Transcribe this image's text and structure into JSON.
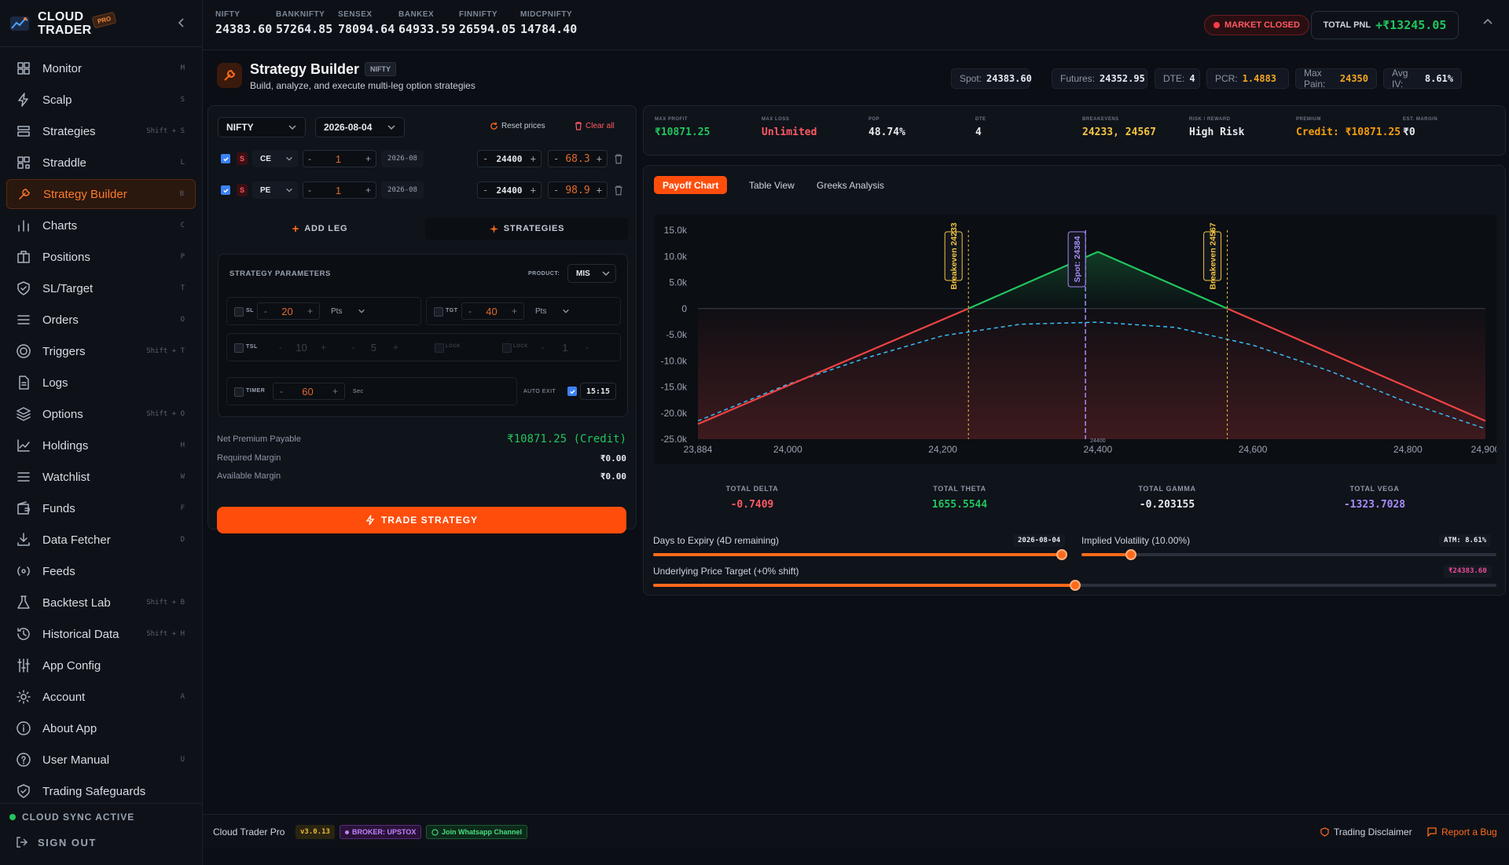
{
  "brand": {
    "line1": "CLOUD",
    "line2": "TRADER",
    "badge": "PRO"
  },
  "nav": [
    {
      "label": "Monitor",
      "shortcut": "M",
      "icon": "grid-icon"
    },
    {
      "label": "Scalp",
      "shortcut": "S",
      "icon": "bolt-icon"
    },
    {
      "label": "Strategies",
      "shortcut": "Shift + S",
      "icon": "layers-icon"
    },
    {
      "label": "Straddle",
      "shortcut": "L",
      "icon": "straddle-icon"
    },
    {
      "label": "Strategy Builder",
      "shortcut": "B",
      "icon": "wrench-icon",
      "active": true
    },
    {
      "label": "Charts",
      "shortcut": "C",
      "icon": "bar-chart-icon"
    },
    {
      "label": "Positions",
      "shortcut": "P",
      "icon": "briefcase-icon"
    },
    {
      "label": "SL/Target",
      "shortcut": "T",
      "icon": "shield-icon"
    },
    {
      "label": "Orders",
      "shortcut": "O",
      "icon": "list-icon"
    },
    {
      "label": "Triggers",
      "shortcut": "Shift + T",
      "icon": "target-icon"
    },
    {
      "label": "Logs",
      "shortcut": "",
      "icon": "file-icon"
    },
    {
      "label": "Options",
      "shortcut": "Shift + O",
      "icon": "stack-icon"
    },
    {
      "label": "Holdings",
      "shortcut": "H",
      "icon": "trend-icon"
    },
    {
      "label": "Watchlist",
      "shortcut": "W",
      "icon": "list-icon"
    },
    {
      "label": "Funds",
      "shortcut": "F",
      "icon": "wallet-icon"
    },
    {
      "label": "Data Fetcher",
      "shortcut": "D",
      "icon": "download-icon"
    },
    {
      "label": "Feeds",
      "shortcut": "",
      "icon": "broadcast-icon"
    },
    {
      "label": "Backtest Lab",
      "shortcut": "Shift + B",
      "icon": "flask-icon"
    },
    {
      "label": "Historical Data",
      "shortcut": "Shift + H",
      "icon": "history-icon"
    },
    {
      "label": "App Config",
      "shortcut": "",
      "icon": "sliders-icon"
    },
    {
      "label": "Account",
      "shortcut": "A",
      "icon": "gear-icon"
    },
    {
      "label": "About App",
      "shortcut": "",
      "icon": "info-icon"
    },
    {
      "label": "User Manual",
      "shortcut": "U",
      "icon": "help-icon"
    },
    {
      "label": "Trading Safeguards",
      "shortcut": "",
      "icon": "shield-icon"
    }
  ],
  "sync": "CLOUD SYNC ACTIVE",
  "signout": "SIGN OUT",
  "indices": [
    {
      "name": "NIFTY",
      "value": "24383.60"
    },
    {
      "name": "BANKNIFTY",
      "value": "57264.85"
    },
    {
      "name": "SENSEX",
      "value": "78094.64"
    },
    {
      "name": "BANKEX",
      "value": "64933.59"
    },
    {
      "name": "FINNIFTY",
      "value": "26594.05"
    },
    {
      "name": "MIDCPNIFTY",
      "value": "14784.40"
    }
  ],
  "market_status": "MARKET CLOSED",
  "pnl": {
    "label": "TOTAL PNL",
    "value": "+₹13245.05"
  },
  "header": {
    "title": "Strategy Builder",
    "tag": "NIFTY",
    "subtitle": "Build, analyze, and execute multi-leg option strategies",
    "stats": [
      {
        "k": "Spot:",
        "v": "24383.60",
        "color": "#e6e9ef"
      },
      {
        "k": "Futures:",
        "v": "24352.95",
        "color": "#e6e9ef"
      },
      {
        "k": "DTE:",
        "v": "4",
        "color": "#e6e9ef"
      },
      {
        "k": "PCR:",
        "v": "1.4883",
        "color": "#f5a623"
      },
      {
        "k": "Max Pain:",
        "v": "24350",
        "color": "#f5a623"
      },
      {
        "k": "Avg IV:",
        "v": "8.61%",
        "color": "#e6e9ef"
      }
    ]
  },
  "builder": {
    "symbol": "NIFTY",
    "expiry": "2026-08-04",
    "reset": "Reset prices",
    "clear": "Clear all",
    "legs": [
      {
        "side": "S",
        "type": "CE",
        "qty": "1",
        "exp": "2026-08",
        "strike": "24400",
        "price": "68.3"
      },
      {
        "side": "S",
        "type": "PE",
        "qty": "1",
        "exp": "2026-08",
        "strike": "24400",
        "price": "98.9"
      }
    ],
    "add_leg": "ADD LEG",
    "strategies": "STRATEGIES",
    "params": {
      "title": "STRATEGY PARAMETERS",
      "product_label": "PRODUCT:",
      "product": "MIS",
      "sl_label": "SL",
      "sl": "20",
      "sl_unit": "Pts",
      "tgt_label": "TGT",
      "tgt": "40",
      "tgt_unit": "Pts",
      "tsl_label": "TSL",
      "tsl_a": "10",
      "tsl_b": "5",
      "lock_label": "LOCK",
      "lock_x_label": "LOCK",
      "lock_val": "1",
      "timer_label": "TIMER",
      "timer": "60",
      "timer_unit": "Sec",
      "auto_exit_label": "AUTO EXIT",
      "auto_exit_time": "15:15"
    },
    "summary": {
      "premium_label": "Net Premium Payable",
      "premium": "₹10871.25 (Credit)",
      "margin_label": "Required Margin",
      "margin": "₹0.00",
      "avail_label": "Available Margin",
      "avail": "₹0.00"
    },
    "trade": "TRADE STRATEGY"
  },
  "metrics": [
    {
      "k": "MAX PROFIT",
      "v": "₹10871.25",
      "color": "#22c55e"
    },
    {
      "k": "MAX LOSS",
      "v": "Unlimited",
      "color": "#ff5a63"
    },
    {
      "k": "POP",
      "v": "48.74%",
      "color": "#e6e9ef"
    },
    {
      "k": "DTE",
      "v": "4",
      "color": "#e6e9ef"
    },
    {
      "k": "BREAKEVENS",
      "v": "24233, 24567",
      "color": "#f5c542"
    },
    {
      "k": "RISK / REWARD",
      "v": "High Risk",
      "color": "#e6e9ef"
    },
    {
      "k": "PREMIUM",
      "v": "Credit: ₹10871.25",
      "color": "#f59e0b"
    },
    {
      "k": "EST. MARGIN",
      "v": "₹0",
      "color": "#e6e9ef"
    }
  ],
  "tabs": [
    "Payoff Chart",
    "Table View",
    "Greeks Analysis"
  ],
  "chart_data": {
    "type": "line",
    "title": "",
    "xlabel": "",
    "ylabel": "",
    "xlim": [
      23884,
      24900
    ],
    "ylim": [
      -25000,
      15000
    ],
    "x_ticks": [
      "23,884",
      "24,000",
      "24,200",
      "24,400",
      "24,600",
      "24,800",
      "24,900"
    ],
    "y_ticks": [
      "15.0k",
      "10.0k",
      "5.0k",
      "0",
      "-5.0k",
      "-10.0k",
      "-15.0k",
      "-20.0k",
      "-25.0k"
    ],
    "series": [
      {
        "style": "solid",
        "x": [
          23884,
          24233,
          24400,
          24567,
          24900
        ],
        "y": [
          -22100,
          0,
          10871,
          0,
          -21500
        ]
      },
      {
        "style": "dashed",
        "x": [
          23884,
          24000,
          24100,
          24200,
          24300,
          24400,
          24500,
          24600,
          24700,
          24800,
          24900
        ],
        "y": [
          -21500,
          -14500,
          -9500,
          -5200,
          -3000,
          -2600,
          -3600,
          -7000,
          -12000,
          -18000,
          -23000
        ]
      }
    ],
    "vlines": [
      {
        "x": 24233,
        "label": "Breakeven 24233",
        "color": "#f5c542"
      },
      {
        "x": 24384,
        "label": "Spot: 24384",
        "color": "#a78bfa"
      },
      {
        "x": 24567,
        "label": "Breakeven 24567",
        "color": "#f5c542"
      }
    ],
    "annotation": "24400"
  },
  "greeks": [
    {
      "k": "TOTAL DELTA",
      "v": "-0.7409",
      "color": "#ff5a63"
    },
    {
      "k": "TOTAL THETA",
      "v": "1655.5544",
      "color": "#22c55e"
    },
    {
      "k": "TOTAL GAMMA",
      "v": "-0.203155",
      "color": "#e6e9ef"
    },
    {
      "k": "TOTAL VEGA",
      "v": "-1323.7028",
      "color": "#a78bfa"
    }
  ],
  "sliders": {
    "dte_label": "Days to Expiry (4D remaining)",
    "dte_chip": "2026-08-04",
    "dte_value": 1.0,
    "iv_label": "Implied Volatility (10.00%)",
    "iv_chip": "ATM: 8.61%",
    "iv_value": 0.12,
    "price_label": "Underlying Price Target (+0% shift)",
    "price_chip": "₹24383.60",
    "price_value": 0.5
  },
  "footer": {
    "app": "Cloud Trader Pro",
    "version": "v3.0.13",
    "broker": "BROKER: UPSTOX",
    "whatsapp": "Join Whatsapp Channel",
    "disclaimer": "Trading Disclaimer",
    "bug": "Report a Bug"
  }
}
